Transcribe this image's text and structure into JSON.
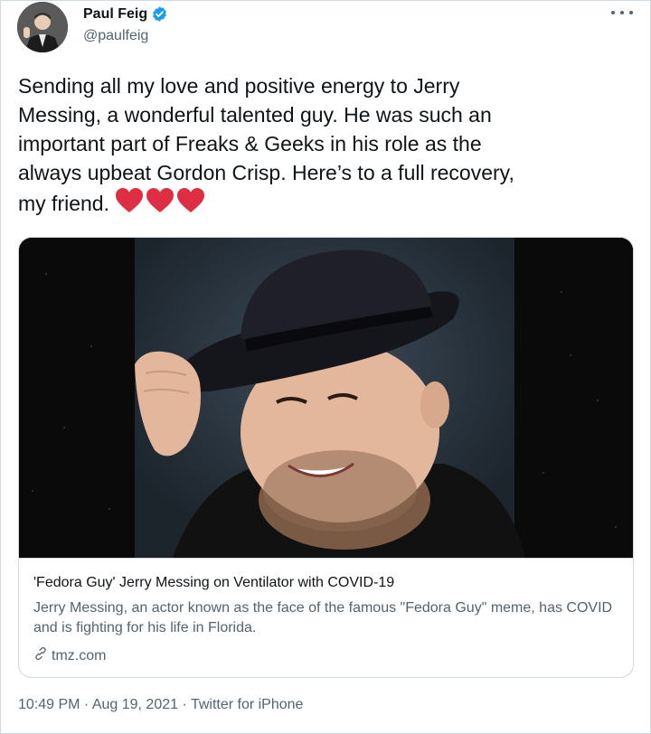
{
  "author": {
    "display_name": "Paul Feig",
    "handle": "@paulfeig"
  },
  "tweet": {
    "text": "Sending all my love and positive energy to Jerry\nMessing, a wonderful talented guy. He was such an\nimportant part of Freaks & Geeks in his role as the\nalways upbeat Gordon Crisp. Here’s to a full recovery,\nmy friend.",
    "emojis": [
      "red-heart",
      "red-heart",
      "red-heart"
    ]
  },
  "link_card": {
    "title": "'Fedora Guy' Jerry Messing on Ventilator with COVID-19",
    "description": "Jerry Messing, an actor known as the face of the famous \"Fedora Guy\" meme, has COVID and is fighting for his life in Florida.",
    "domain": "tmz.com"
  },
  "meta": {
    "timestamp": "10:49 PM · Aug 19, 2021 · Twitter for iPhone"
  },
  "colors": {
    "text": "#0f1419",
    "secondary": "#536471",
    "border": "#cfd9de",
    "verified": "#1d9bf0",
    "heart": "#dd2e44"
  }
}
